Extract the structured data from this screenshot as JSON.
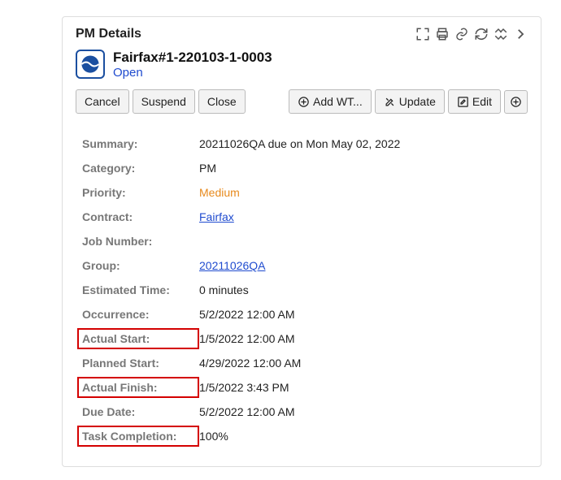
{
  "header": {
    "title": "PM Details"
  },
  "record": {
    "title": "Fairfax#1-220103-1-0003",
    "status": "Open"
  },
  "toolbar": {
    "cancel": "Cancel",
    "suspend": "Suspend",
    "close": "Close",
    "add_wt": "Add WT...",
    "update": "Update",
    "edit": "Edit"
  },
  "fields": {
    "summary_label": "Summary:",
    "summary_value": "20211026QA due on Mon May 02, 2022",
    "category_label": "Category:",
    "category_value": "PM",
    "priority_label": "Priority:",
    "priority_value": "Medium",
    "contract_label": "Contract:",
    "contract_value": "Fairfax",
    "jobnumber_label": "Job Number:",
    "jobnumber_value": "",
    "group_label": "Group:",
    "group_value": "20211026QA",
    "esttime_label": "Estimated Time:",
    "esttime_value": "0 minutes",
    "occurrence_label": "Occurrence:",
    "occurrence_value": "5/2/2022 12:00 AM",
    "actualstart_label": "Actual Start:",
    "actualstart_value": "1/5/2022 12:00 AM",
    "plannedstart_label": "Planned Start:",
    "plannedstart_value": "4/29/2022 12:00 AM",
    "actualfinish_label": "Actual Finish:",
    "actualfinish_value": "1/5/2022 3:43 PM",
    "duedate_label": "Due Date:",
    "duedate_value": "5/2/2022 12:00 AM",
    "taskcompletion_label": "Task Completion:",
    "taskcompletion_value": "100%"
  }
}
